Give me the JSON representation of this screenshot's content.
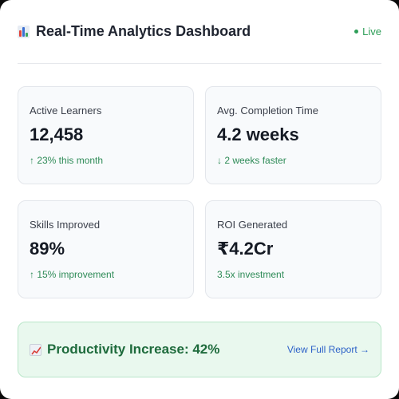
{
  "header": {
    "title": "Real-Time Analytics Dashboard",
    "title_icon": "bar-chart-icon",
    "status": "Live",
    "status_color": "#2e9e58"
  },
  "stats": [
    {
      "label": "Active Learners",
      "value": "12,458",
      "sub": "↑ 23% this month"
    },
    {
      "label": "Avg. Completion Time",
      "value": "4.2 weeks",
      "sub": "↓ 2 weeks faster"
    },
    {
      "label": "Skills Improved",
      "value": "89%",
      "sub": "↑ 15% improvement"
    },
    {
      "label": "ROI Generated",
      "value": "₹4.2Cr",
      "sub": "3.5x investment"
    }
  ],
  "banner": {
    "icon": "trend-chart-icon",
    "text": "Productivity Increase: 42%",
    "link": "View Full Report →",
    "accent": "#1e6b3c",
    "link_color": "#2d62c8"
  }
}
